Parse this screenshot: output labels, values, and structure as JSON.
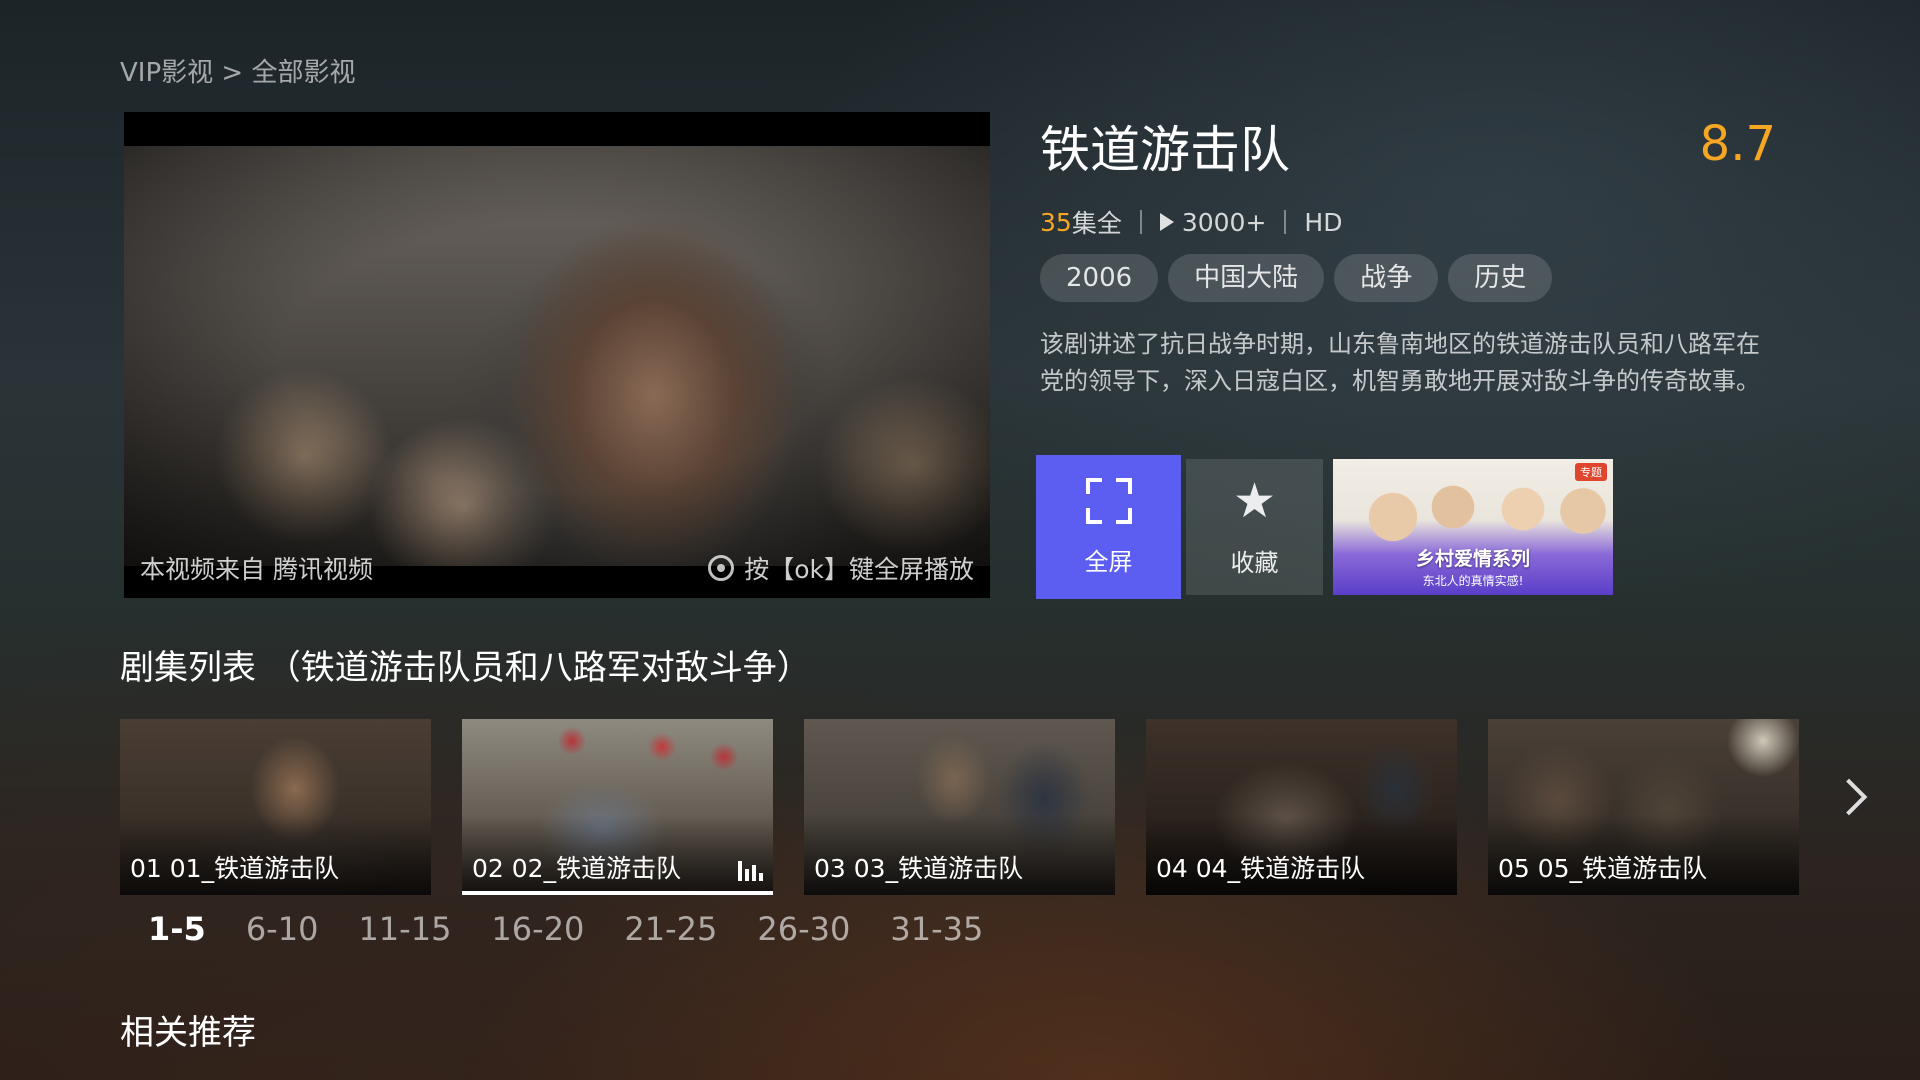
{
  "breadcrumb": "VIP影视 > 全部影视",
  "player": {
    "source_text": "本视频来自 腾讯视频",
    "hint_text": "按【ok】键全屏播放"
  },
  "info": {
    "title": "铁道游击队",
    "score": "8.7",
    "episode_count": "35",
    "episode_suffix": "集全",
    "plays": "3000+",
    "quality": "HD",
    "tags": [
      "2006",
      "中国大陆",
      "战争",
      "历史"
    ],
    "description": "该剧讲述了抗日战争时期，山东鲁南地区的铁道游击队员和八路军在党的领导下，深入日寇白区，机智勇敢地开展对敌斗争的传奇故事。"
  },
  "actions": {
    "fullscreen_label": "全屏",
    "favorite_label": "收藏",
    "promo": {
      "badge": "专题",
      "title": "乡村爱情系列",
      "subtitle": "东北人的真情实感!"
    }
  },
  "episodes_section": {
    "title": "剧集列表 （铁道游击队员和八路军对敌斗争）",
    "items": [
      {
        "label": "01 01_铁道游击队",
        "active": false
      },
      {
        "label": "02 02_铁道游击队",
        "active": true
      },
      {
        "label": "03 03_铁道游击队",
        "active": false
      },
      {
        "label": "04 04_铁道游击队",
        "active": false
      },
      {
        "label": "05 05_铁道游击队",
        "active": false
      }
    ],
    "pages": [
      "1-5",
      "6-10",
      "11-15",
      "16-20",
      "21-25",
      "26-30",
      "31-35"
    ],
    "active_page": "1-5"
  },
  "related_section": {
    "title": "相关推荐"
  },
  "colors": {
    "accent": "#5b5ef0",
    "score": "#f5a623"
  }
}
